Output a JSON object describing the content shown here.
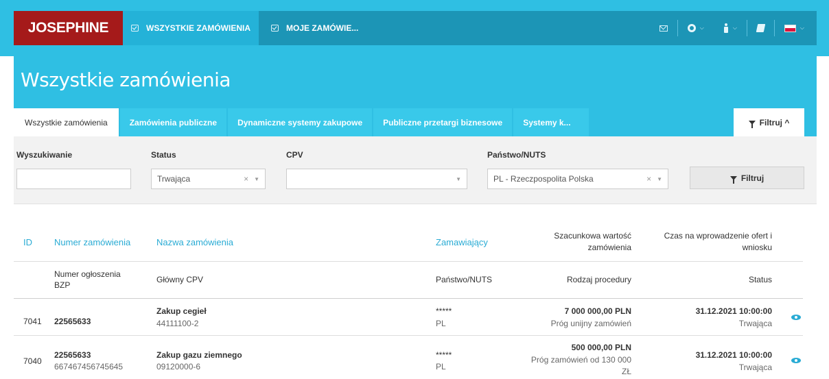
{
  "nav": {
    "logo": "JOSEPHINE",
    "items": [
      {
        "label": "WSZYSTKIE ZAMÓWIENIA",
        "active": true
      },
      {
        "label": "MOJE ZAMÓWIE...",
        "active": false
      }
    ],
    "icons": [
      "mail-icon",
      "gear-icon",
      "person-icon",
      "book-icon",
      "flag-pl-icon"
    ]
  },
  "header": {
    "title": "Wszystkie zamówienia",
    "tabs": [
      "Wszystkie zamówienia",
      "Zamówienia publiczne",
      "Dynamiczne systemy zakupowe",
      "Publiczne przetargi biznesowe",
      "Systemy k..."
    ],
    "filter_toggle": "Filtruj ^"
  },
  "filters": {
    "search": {
      "label": "Wyszukiwanie",
      "value": ""
    },
    "status": {
      "label": "Status",
      "value": "Trwająca"
    },
    "cpv": {
      "label": "CPV",
      "value": ""
    },
    "country": {
      "label": "Państwo/NUTS",
      "value": "PL - Rzeczpospolita Polska"
    },
    "button": "Filtruj"
  },
  "table": {
    "header1": {
      "id": "ID",
      "number": "Numer zamówienia",
      "name": "Nazwa zamówienia",
      "buyer": "Zamawiający",
      "value_line1": "Szacunkowa wartość",
      "value_line2": "zamówienia",
      "deadline_line1": "Czas na wprowadzenie ofert i",
      "deadline_line2": "wniosku"
    },
    "header2": {
      "notice_line1": "Numer ogłoszenia",
      "notice_line2": "BZP",
      "cpv": "Główny CPV",
      "country": "Państwo/NUTS",
      "procedure": "Rodzaj procedury",
      "status": "Status"
    },
    "rows": [
      {
        "id": "7041",
        "number": "22565633",
        "notice": "",
        "name": "Zakup cegieł",
        "cpv": "44111100-2",
        "buyer": "*****",
        "country": "PL",
        "value": "7 000 000,00 PLN",
        "procedure_line1": "Próg unijny zamówień",
        "procedure_line2": "",
        "deadline": "31.12.2021 10:00:00",
        "status": "Trwająca"
      },
      {
        "id": "7040",
        "number": "22565633",
        "notice": "667467456745645",
        "name": "Zakup gazu ziemnego",
        "cpv": "09120000-6",
        "buyer": "*****",
        "country": "PL",
        "value": "500 000,00 PLN",
        "procedure_line1": "Próg zamówień od 130 000",
        "procedure_line2": "ZŁ",
        "deadline": "31.12.2021 10:00:00",
        "status": "Trwająca"
      }
    ]
  }
}
